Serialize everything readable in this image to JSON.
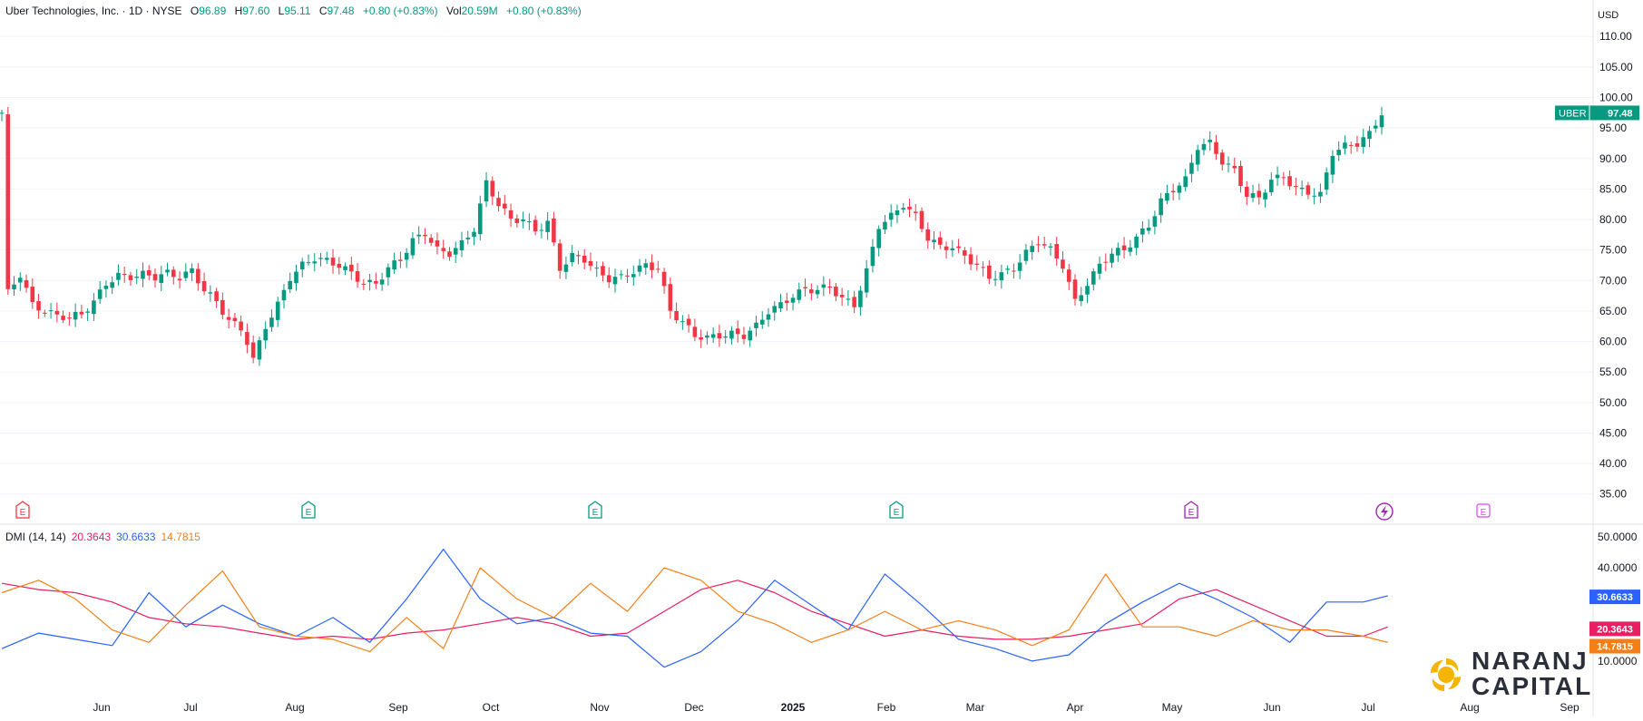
{
  "header": {
    "symbol_name": "Uber Technologies, Inc. · 1D · NYSE",
    "open_label": "O",
    "open": "96.89",
    "high_label": "H",
    "high": "97.60",
    "low_label": "L",
    "low": "95.11",
    "close_label": "C",
    "close": "97.48",
    "change": "+0.80 (+0.83%)",
    "vol_label": "Vol",
    "vol": "20.59M",
    "vol_change": "+0.80 (+0.83%)"
  },
  "currency": "USD",
  "price_badge": {
    "ticker": "UBER",
    "value": "97.48"
  },
  "dmi": {
    "title": "DMI (14, 14)",
    "adx": "20.3643",
    "plus_di": "30.6633",
    "minus_di": "14.7815"
  },
  "colors": {
    "up": "#089981",
    "down": "#f23645",
    "adx": "#e91e63",
    "plus_di": "#2962ff",
    "minus_di": "#f57f17",
    "text": "#131722",
    "grid": "#f0f3fa"
  },
  "logo": {
    "line1": "NARANJ",
    "line2": "CAPITAL"
  },
  "chart_data": [
    {
      "type": "candlestick",
      "title": "",
      "y_range": [
        30.5,
        113.6
      ],
      "y_ticks": [
        "110.00",
        "105.00",
        "100.00",
        "95.00",
        "90.00",
        "85.00",
        "80.00",
        "75.00",
        "70.00",
        "65.00",
        "60.00",
        "55.00",
        "50.00",
        "45.00",
        "40.00",
        "35.00"
      ],
      "x_ticks": [
        "Jun",
        "Jul",
        "Aug",
        "Sep",
        "Oct",
        "Nov",
        "Dec",
        "2025",
        "Feb",
        "Mar",
        "Apr",
        "May",
        "Jun",
        "Jul",
        "Aug",
        "Sep"
      ],
      "close_path": [
        [
          1,
          68
        ],
        [
          3,
          71
        ],
        [
          5,
          66
        ],
        [
          7,
          65
        ],
        [
          9,
          64.2
        ],
        [
          11,
          64
        ],
        [
          13,
          64.5
        ],
        [
          15,
          66.5
        ],
        [
          17,
          69.5
        ],
        [
          19,
          70.8
        ],
        [
          21,
          70.6
        ],
        [
          23,
          71
        ],
        [
          25,
          70.6
        ],
        [
          27,
          71.2
        ],
        [
          29,
          70.5
        ],
        [
          31,
          71.6
        ],
        [
          33,
          68.5
        ],
        [
          35,
          66.5
        ],
        [
          37,
          63.5
        ],
        [
          39,
          62
        ],
        [
          40,
          60
        ],
        [
          41,
          57
        ],
        [
          43,
          62.5
        ],
        [
          45,
          66
        ],
        [
          47,
          70.5
        ],
        [
          49,
          72.5
        ],
        [
          51,
          73.7
        ],
        [
          53,
          73.2
        ],
        [
          55,
          72.5
        ],
        [
          57,
          71.2
        ],
        [
          59,
          69.5
        ],
        [
          61,
          69.5
        ],
        [
          63,
          72
        ],
        [
          65,
          73.5
        ],
        [
          67,
          76.5
        ],
        [
          69,
          77.8
        ],
        [
          71,
          75
        ],
        [
          73,
          74.5
        ],
        [
          75,
          76
        ],
        [
          77,
          78.5
        ],
        [
          79,
          86
        ],
        [
          81,
          82.5
        ],
        [
          83,
          80
        ],
        [
          85,
          80
        ],
        [
          87,
          78.2
        ],
        [
          89,
          79.5
        ],
        [
          91,
          72
        ],
        [
          93,
          74
        ],
        [
          95,
          73.5
        ],
        [
          97,
          71.5
        ],
        [
          99,
          70.3
        ],
        [
          101,
          70.5
        ],
        [
          103,
          71.5
        ],
        [
          105,
          72.5
        ],
        [
          107,
          72
        ],
        [
          109,
          65
        ],
        [
          111,
          63.2
        ],
        [
          113,
          61
        ],
        [
          115,
          60.6
        ],
        [
          117,
          61
        ],
        [
          119,
          61.2
        ],
        [
          121,
          61
        ],
        [
          123,
          62.5
        ],
        [
          125,
          65
        ],
        [
          127,
          66
        ],
        [
          129,
          67.5
        ],
        [
          131,
          68.5
        ],
        [
          133,
          68.5
        ],
        [
          135,
          69
        ],
        [
          137,
          67
        ],
        [
          139,
          66
        ],
        [
          141,
          71.5
        ],
        [
          143,
          79
        ],
        [
          145,
          80.5
        ],
        [
          147,
          82.5
        ],
        [
          149,
          80.5
        ],
        [
          151,
          77
        ],
        [
          153,
          75.5
        ],
        [
          155,
          75.5
        ],
        [
          157,
          74
        ],
        [
          159,
          72.5
        ],
        [
          161,
          70.5
        ],
        [
          163,
          71
        ],
        [
          165,
          72
        ],
        [
          167,
          74.5
        ],
        [
          169,
          76.5
        ],
        [
          171,
          75
        ],
        [
          173,
          72.5
        ],
        [
          175,
          66.5
        ],
        [
          177,
          69.5
        ],
        [
          179,
          72.5
        ],
        [
          181,
          74.5
        ],
        [
          183,
          75
        ],
        [
          185,
          77
        ],
        [
          187,
          79
        ],
        [
          189,
          83
        ],
        [
          191,
          85
        ],
        [
          193,
          86.5
        ],
        [
          195,
          92
        ],
        [
          197,
          92.5
        ],
        [
          199,
          89.5
        ],
        [
          201,
          88
        ],
        [
          203,
          84
        ],
        [
          205,
          83.5
        ],
        [
          207,
          86.5
        ],
        [
          209,
          87
        ],
        [
          211,
          85
        ],
        [
          213,
          84.5
        ],
        [
          215,
          84
        ],
        [
          217,
          91
        ],
        [
          219,
          92
        ],
        [
          221,
          92.5
        ],
        [
          223,
          94
        ],
        [
          225,
          97.5
        ]
      ],
      "earnings_markers": 6,
      "last_price": 97.48
    },
    {
      "type": "line",
      "title": "DMI (14, 14)",
      "y_range": [
        -2,
        52
      ],
      "y_ticks": [
        "50.0000",
        "40.0000",
        "10.0000"
      ],
      "series": [
        {
          "name": "ADX",
          "color": "#e91e63",
          "last": 20.3643,
          "points": [
            [
              0,
              35
            ],
            [
              6,
              33
            ],
            [
              12,
              32
            ],
            [
              18,
              29
            ],
            [
              24,
              24
            ],
            [
              30,
              22
            ],
            [
              36,
              21
            ],
            [
              42,
              19
            ],
            [
              48,
              17
            ],
            [
              54,
              18
            ],
            [
              60,
              17
            ],
            [
              66,
              19
            ],
            [
              72,
              20
            ],
            [
              78,
              22
            ],
            [
              84,
              24
            ],
            [
              90,
              22
            ],
            [
              96,
              18
            ],
            [
              102,
              19
            ],
            [
              108,
              26
            ],
            [
              114,
              33
            ],
            [
              120,
              36
            ],
            [
              126,
              32
            ],
            [
              132,
              26
            ],
            [
              138,
              22
            ],
            [
              144,
              18
            ],
            [
              150,
              20
            ],
            [
              156,
              18
            ],
            [
              162,
              17
            ],
            [
              168,
              17
            ],
            [
              174,
              18
            ],
            [
              180,
              20
            ],
            [
              186,
              22
            ],
            [
              192,
              30
            ],
            [
              198,
              33
            ],
            [
              204,
              28
            ],
            [
              210,
              23
            ],
            [
              216,
              18
            ],
            [
              222,
              18
            ],
            [
              226,
              21
            ]
          ]
        },
        {
          "name": "+DI",
          "color": "#2962ff",
          "last": 30.6633,
          "points": [
            [
              0,
              14
            ],
            [
              6,
              19
            ],
            [
              12,
              17
            ],
            [
              18,
              15
            ],
            [
              24,
              32
            ],
            [
              30,
              21
            ],
            [
              36,
              28
            ],
            [
              42,
              22
            ],
            [
              48,
              18
            ],
            [
              54,
              24
            ],
            [
              60,
              16
            ],
            [
              66,
              30
            ],
            [
              72,
              46
            ],
            [
              78,
              30
            ],
            [
              84,
              22
            ],
            [
              90,
              24
            ],
            [
              96,
              19
            ],
            [
              102,
              18
            ],
            [
              108,
              8
            ],
            [
              114,
              13
            ],
            [
              120,
              23
            ],
            [
              126,
              36
            ],
            [
              132,
              28
            ],
            [
              138,
              20
            ],
            [
              144,
              38
            ],
            [
              150,
              28
            ],
            [
              156,
              17
            ],
            [
              162,
              14
            ],
            [
              168,
              10
            ],
            [
              174,
              12
            ],
            [
              180,
              22
            ],
            [
              186,
              29
            ],
            [
              192,
              35
            ],
            [
              198,
              30
            ],
            [
              204,
              24
            ],
            [
              210,
              16
            ],
            [
              216,
              29
            ],
            [
              222,
              29
            ],
            [
              226,
              31
            ]
          ]
        },
        {
          "name": "-DI",
          "color": "#f57f17",
          "last": 14.7815,
          "points": [
            [
              0,
              32
            ],
            [
              6,
              36
            ],
            [
              12,
              30
            ],
            [
              18,
              20
            ],
            [
              24,
              16
            ],
            [
              30,
              28
            ],
            [
              36,
              39
            ],
            [
              42,
              21
            ],
            [
              48,
              18
            ],
            [
              54,
              17
            ],
            [
              60,
              13
            ],
            [
              66,
              24
            ],
            [
              72,
              14
            ],
            [
              78,
              40
            ],
            [
              84,
              30
            ],
            [
              90,
              24
            ],
            [
              96,
              35
            ],
            [
              102,
              26
            ],
            [
              108,
              40
            ],
            [
              114,
              36
            ],
            [
              120,
              26
            ],
            [
              126,
              22
            ],
            [
              132,
              16
            ],
            [
              138,
              20
            ],
            [
              144,
              26
            ],
            [
              150,
              20
            ],
            [
              156,
              23
            ],
            [
              162,
              20
            ],
            [
              168,
              15
            ],
            [
              174,
              20
            ],
            [
              180,
              38
            ],
            [
              186,
              21
            ],
            [
              192,
              21
            ],
            [
              198,
              18
            ],
            [
              204,
              23
            ],
            [
              210,
              20
            ],
            [
              216,
              20
            ],
            [
              222,
              18
            ],
            [
              226,
              16
            ]
          ]
        }
      ]
    }
  ]
}
